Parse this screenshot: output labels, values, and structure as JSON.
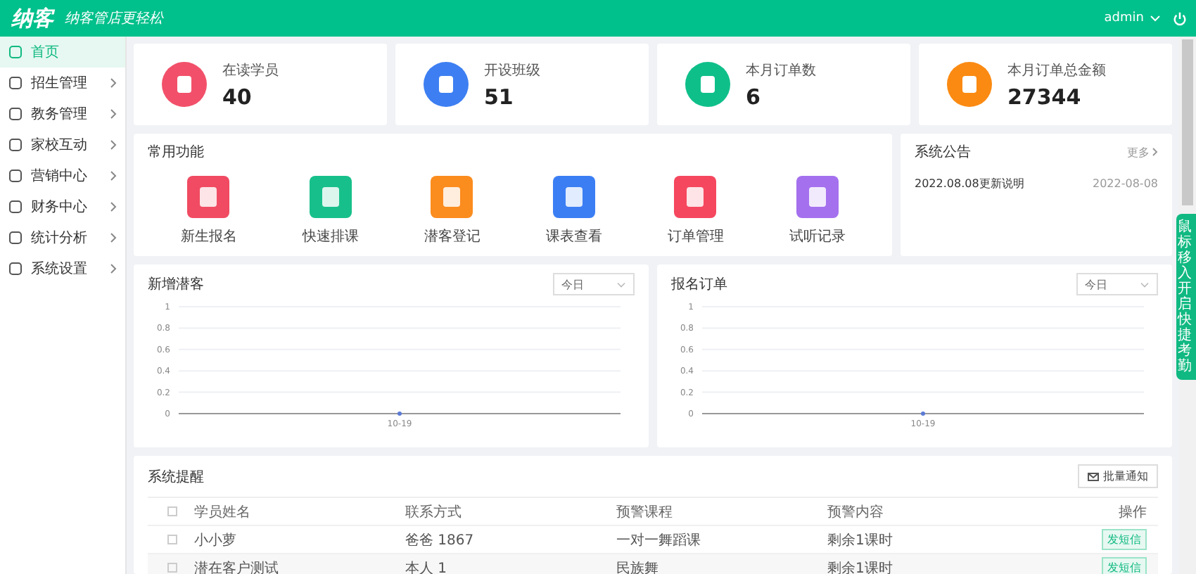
{
  "header": {
    "logo": "纳客",
    "slogan": "纳客管店更轻松",
    "user": "admin"
  },
  "sidebar": {
    "items": [
      {
        "label": "首页",
        "selected": true,
        "has_submenu": false
      },
      {
        "label": "招生管理",
        "selected": false,
        "has_submenu": true
      },
      {
        "label": "教务管理",
        "selected": false,
        "has_submenu": true
      },
      {
        "label": "家校互动",
        "selected": false,
        "has_submenu": true
      },
      {
        "label": "营销中心",
        "selected": false,
        "has_submenu": true
      },
      {
        "label": "财务中心",
        "selected": false,
        "has_submenu": true
      },
      {
        "label": "统计分析",
        "selected": false,
        "has_submenu": true
      },
      {
        "label": "系统设置",
        "selected": false,
        "has_submenu": true
      }
    ]
  },
  "stats": [
    {
      "label": "在读学员",
      "value": "40",
      "color": "#f2506a"
    },
    {
      "label": "开设班级",
      "value": "51",
      "color": "#3d7ff2"
    },
    {
      "label": "本月订单数",
      "value": "6",
      "color": "#0fbf8a"
    },
    {
      "label": "本月订单总金额",
      "value": "27344",
      "color": "#fb8a12"
    }
  ],
  "quick_functions": {
    "title": "常用功能",
    "items": [
      {
        "label": "新生报名",
        "color": "#f04b62"
      },
      {
        "label": "快速排课",
        "color": "#17c08a"
      },
      {
        "label": "潜客登记",
        "color": "#fb8c1e"
      },
      {
        "label": "课表查看",
        "color": "#3b7ef4"
      },
      {
        "label": "订单管理",
        "color": "#f5475e"
      },
      {
        "label": "试听记录",
        "color": "#a470ee"
      }
    ]
  },
  "notices": {
    "title": "系统公告",
    "more": "更多",
    "items": [
      {
        "title": "2022.08.08更新说明",
        "date": "2022-08-08"
      }
    ]
  },
  "charts": [
    {
      "title": "新增潜客",
      "period": "今日",
      "chart_data": {
        "type": "line",
        "grid": true,
        "categories": [
          "10-19"
        ],
        "series": [
          {
            "color": "#5b7bd5",
            "marker": true,
            "values": [
              0
            ]
          }
        ],
        "ylim": [
          0,
          1
        ],
        "yticks": [
          0,
          0.2,
          0.4,
          0.6,
          0.8,
          1
        ]
      }
    },
    {
      "title": "报名订单",
      "period": "今日",
      "chart_data": {
        "type": "line",
        "grid": true,
        "categories": [
          "10-19"
        ],
        "series": [
          {
            "color": "#5b7bd5",
            "marker": true,
            "values": [
              0
            ]
          }
        ],
        "ylim": [
          0,
          1
        ],
        "yticks": [
          0,
          0.2,
          0.4,
          0.6,
          0.8,
          1
        ]
      }
    }
  ],
  "reminders": {
    "title": "系统提醒",
    "batch_button": "批量通知",
    "all_checked": false,
    "columns": [
      "学员姓名",
      "联系方式",
      "预警课程",
      "预警内容",
      "操作"
    ],
    "rows": [
      {
        "checked": false,
        "name": "小小萝",
        "contact": "爸爸 1867",
        "course": "一对一舞蹈课",
        "content": "剩余1课时",
        "action": "发短信"
      },
      {
        "checked": false,
        "name": "潜在客户测试",
        "contact": "本人 1",
        "course": "民族舞",
        "content": "剩余1课时",
        "action": "发短信"
      }
    ]
  },
  "side_tab": {
    "text": "鼠标移入开启快捷考勤"
  }
}
